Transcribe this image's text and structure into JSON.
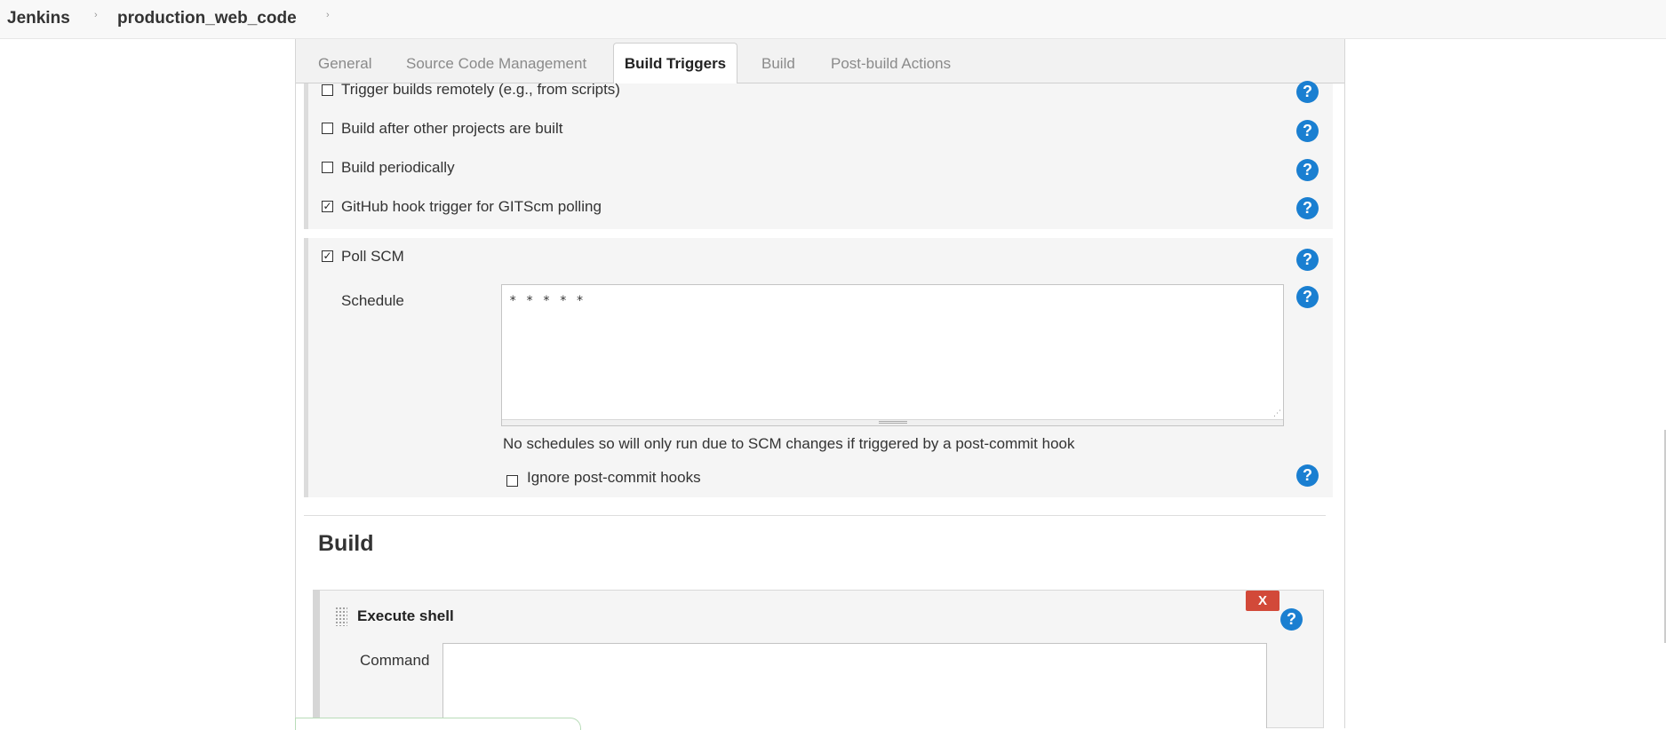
{
  "breadcrumb": {
    "items": [
      "Jenkins",
      "production_web_code"
    ],
    "separator": "›"
  },
  "tabs": [
    {
      "label": "General",
      "active": false
    },
    {
      "label": "Source Code Management",
      "active": false
    },
    {
      "label": "Build Triggers",
      "active": true
    },
    {
      "label": "Build",
      "active": false
    },
    {
      "label": "Post-build Actions",
      "active": false
    }
  ],
  "triggers": [
    {
      "label": "Trigger builds remotely (e.g., from scripts)",
      "checked": false
    },
    {
      "label": "Build after other projects are built",
      "checked": false
    },
    {
      "label": "Build periodically",
      "checked": false
    },
    {
      "label": "GitHub hook trigger for GITScm polling",
      "checked": true
    },
    {
      "label": "Poll SCM",
      "checked": true
    }
  ],
  "poll_scm": {
    "schedule_label": "Schedule",
    "schedule_value": "* * * * *",
    "info_text": "No schedules so will only run due to SCM changes if triggered by a post-commit hook",
    "ignore_hooks_label": "Ignore post-commit hooks",
    "ignore_hooks_checked": false
  },
  "build": {
    "heading": "Build",
    "step_title": "Execute shell",
    "delete_label": "X",
    "command_label": "Command",
    "command_value": ""
  },
  "icons": {
    "help": "help-icon",
    "checkbox_checked_glyph": "✓",
    "help_glyph": "?"
  },
  "colors": {
    "help_blue": "#1a7fd1",
    "delete_red": "#d24939",
    "section_bg": "#f5f5f5"
  }
}
